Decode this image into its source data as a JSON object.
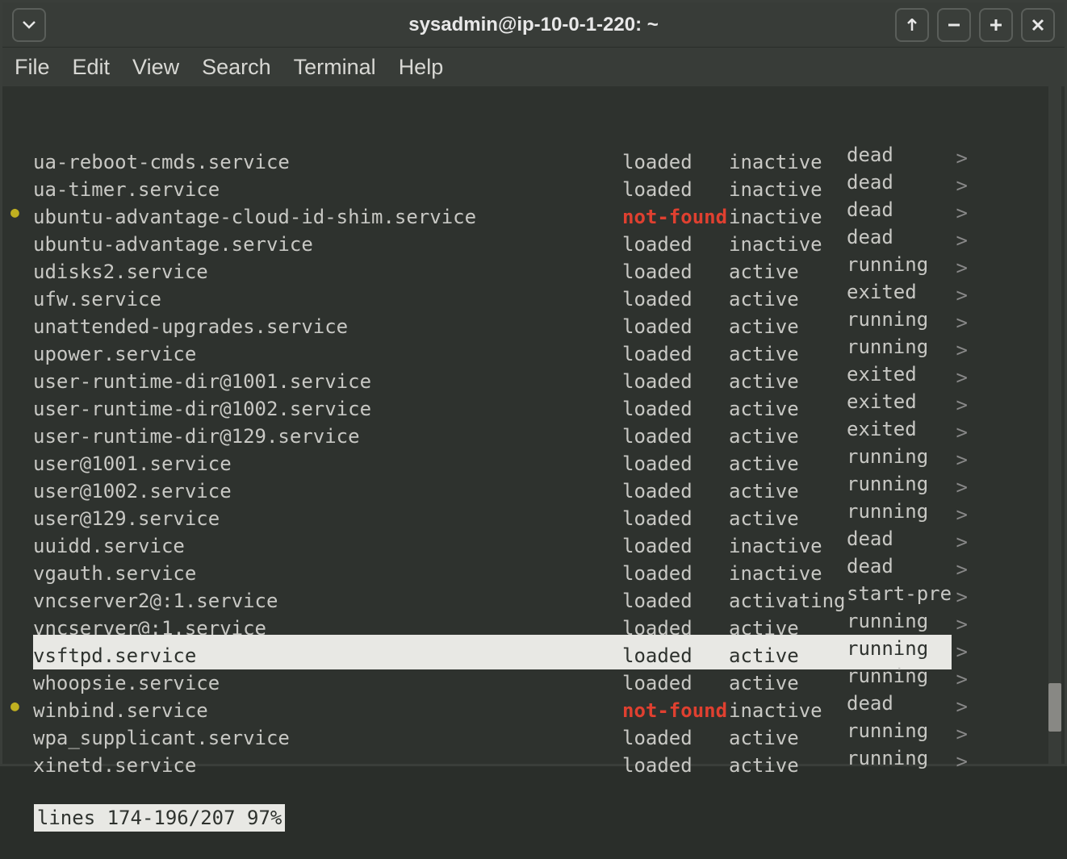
{
  "window": {
    "title": "sysadmin@ip-10-0-1-220: ~"
  },
  "menubar": {
    "items": [
      "File",
      "Edit",
      "View",
      "Search",
      "Terminal",
      "Help"
    ]
  },
  "services": [
    {
      "bullet": "",
      "name": "ua-reboot-cmds.service",
      "load": "loaded",
      "load_style": "",
      "active": "inactive",
      "sub": "dead",
      "hl": false
    },
    {
      "bullet": "",
      "name": "ua-timer.service",
      "load": "loaded",
      "load_style": "",
      "active": "inactive",
      "sub": "dead",
      "hl": false
    },
    {
      "bullet": "●",
      "name": "ubuntu-advantage-cloud-id-shim.service",
      "load": "not-found",
      "load_style": "nf",
      "active": "inactive",
      "sub": "dead",
      "hl": false
    },
    {
      "bullet": "",
      "name": "ubuntu-advantage.service",
      "load": "loaded",
      "load_style": "",
      "active": "inactive",
      "sub": "dead",
      "hl": false
    },
    {
      "bullet": "",
      "name": "udisks2.service",
      "load": "loaded",
      "load_style": "",
      "active": "active",
      "sub": "running",
      "hl": false
    },
    {
      "bullet": "",
      "name": "ufw.service",
      "load": "loaded",
      "load_style": "",
      "active": "active",
      "sub": "exited",
      "hl": false
    },
    {
      "bullet": "",
      "name": "unattended-upgrades.service",
      "load": "loaded",
      "load_style": "",
      "active": "active",
      "sub": "running",
      "hl": false
    },
    {
      "bullet": "",
      "name": "upower.service",
      "load": "loaded",
      "load_style": "",
      "active": "active",
      "sub": "running",
      "hl": false
    },
    {
      "bullet": "",
      "name": "user-runtime-dir@1001.service",
      "load": "loaded",
      "load_style": "",
      "active": "active",
      "sub": "exited",
      "hl": false
    },
    {
      "bullet": "",
      "name": "user-runtime-dir@1002.service",
      "load": "loaded",
      "load_style": "",
      "active": "active",
      "sub": "exited",
      "hl": false
    },
    {
      "bullet": "",
      "name": "user-runtime-dir@129.service",
      "load": "loaded",
      "load_style": "",
      "active": "active",
      "sub": "exited",
      "hl": false
    },
    {
      "bullet": "",
      "name": "user@1001.service",
      "load": "loaded",
      "load_style": "",
      "active": "active",
      "sub": "running",
      "hl": false
    },
    {
      "bullet": "",
      "name": "user@1002.service",
      "load": "loaded",
      "load_style": "",
      "active": "active",
      "sub": "running",
      "hl": false
    },
    {
      "bullet": "",
      "name": "user@129.service",
      "load": "loaded",
      "load_style": "",
      "active": "active",
      "sub": "running",
      "hl": false
    },
    {
      "bullet": "",
      "name": "uuidd.service",
      "load": "loaded",
      "load_style": "",
      "active": "inactive",
      "sub": "dead",
      "hl": false
    },
    {
      "bullet": "",
      "name": "vgauth.service",
      "load": "loaded",
      "load_style": "",
      "active": "inactive",
      "sub": "dead",
      "hl": false
    },
    {
      "bullet": "",
      "name": "vncserver2@:1.service",
      "load": "loaded",
      "load_style": "",
      "active": "activating",
      "sub": "start-pre",
      "hl": false
    },
    {
      "bullet": "",
      "name": "vncserver@:1.service",
      "load": "loaded",
      "load_style": "",
      "active": "active",
      "sub": "running",
      "hl": false
    },
    {
      "bullet": "",
      "name": "vsftpd.service",
      "load": "loaded",
      "load_style": "",
      "active": "active",
      "sub": "running",
      "hl": true
    },
    {
      "bullet": "",
      "name": "whoopsie.service",
      "load": "loaded",
      "load_style": "",
      "active": "active",
      "sub": "running",
      "hl": false
    },
    {
      "bullet": "●",
      "name": "winbind.service",
      "load": "not-found",
      "load_style": "nf",
      "active": "inactive",
      "sub": "dead",
      "hl": false
    },
    {
      "bullet": "",
      "name": "wpa_supplicant.service",
      "load": "loaded",
      "load_style": "",
      "active": "active",
      "sub": "running",
      "hl": false
    },
    {
      "bullet": "",
      "name": "xinetd.service",
      "load": "loaded",
      "load_style": "",
      "active": "active",
      "sub": "running",
      "hl": false
    }
  ],
  "status_line": "lines 174-196/207 97%",
  "arrow_glyph": ">"
}
